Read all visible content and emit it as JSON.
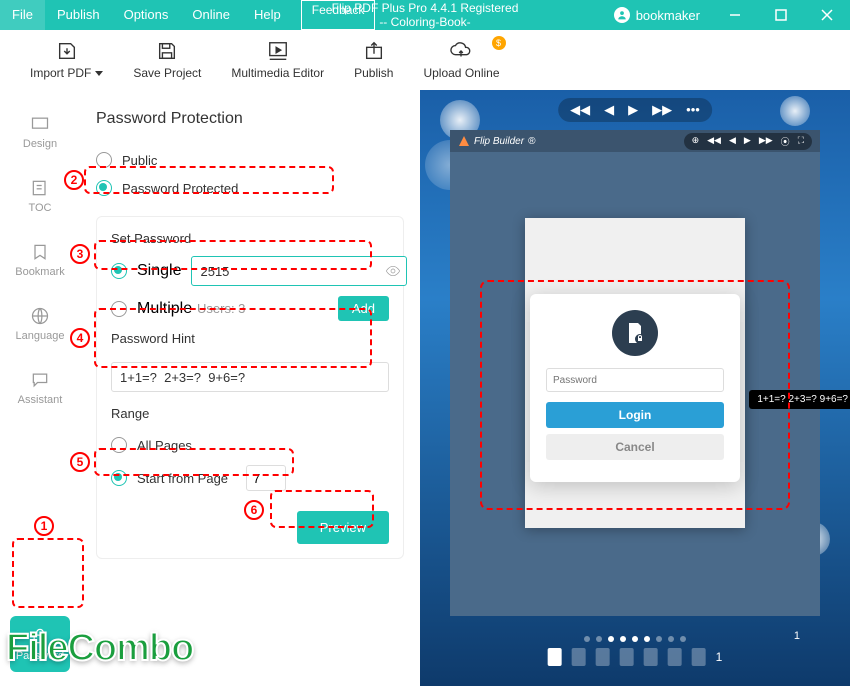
{
  "menu": {
    "file": "File",
    "publish": "Publish",
    "options": "Options",
    "online": "Online",
    "help": "Help",
    "feedback": "Feedback"
  },
  "title": {
    "line1": "Flip PDF Plus Pro 4.4.1 Registered",
    "line2": "-- Coloring-Book-"
  },
  "user": "bookmaker",
  "toolbar": {
    "import": "Import PDF",
    "save": "Save Project",
    "mm": "Multimedia Editor",
    "publish": "Publish",
    "upload": "Upload Online"
  },
  "tabs": {
    "design": "Design",
    "toc": "TOC",
    "bookmark": "Bookmark",
    "language": "Language",
    "assistant": "Assistant",
    "password": "Password"
  },
  "panel": {
    "title": "Password Protection",
    "public": "Public",
    "protected": "Password Protected",
    "setpw": "Set Password",
    "single": "Single",
    "single_value": "2515",
    "multiple": "Multiple",
    "users": "Users: 3",
    "add": "Add",
    "hint_label": "Password Hint",
    "hint_value": "1+1=?  2+3=?  9+6=?",
    "range": "Range",
    "allpages": "All Pages",
    "startfrom": "Start from Page",
    "start_value": "7",
    "preview": "Preview"
  },
  "annotations": {
    "n1": "1",
    "n2": "2",
    "n3": "3",
    "n4": "4",
    "n5": "5",
    "n6": "6"
  },
  "preview": {
    "flipbuilder": "Flip Builder",
    "pw_placeholder": "Password",
    "login": "Login",
    "cancel": "Cancel",
    "tooltip": "1+1=?  2+3=?  9+6=?",
    "page1": "1",
    "page_current": "1"
  },
  "watermark": "FileCombo"
}
